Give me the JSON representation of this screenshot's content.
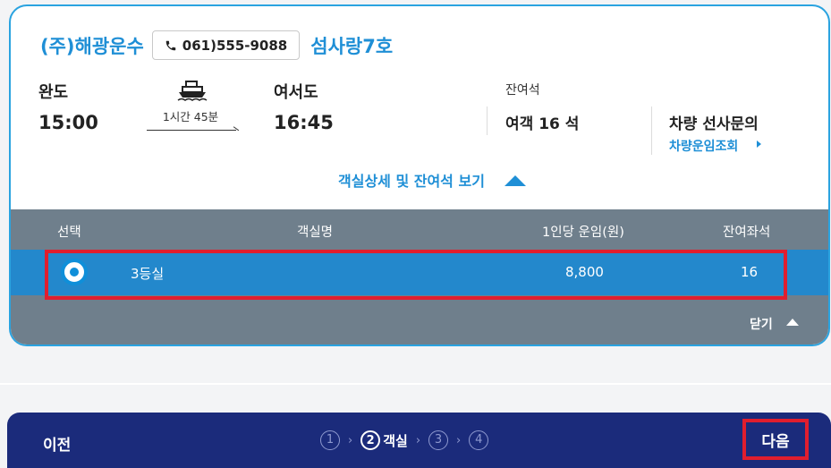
{
  "header": {
    "company": "(주)해광운수",
    "phone": "061)555-9088",
    "ship": "섬사랑7호"
  },
  "route": {
    "from_port": "완도",
    "from_time": "15:00",
    "duration": "1시간 45분",
    "to_port": "여서도",
    "to_time": "16:45"
  },
  "remaining": {
    "label": "잔여석",
    "passengers": "여객 16 석",
    "vehicle": "차량 선사문의",
    "vehicle_link": "차량운임조회"
  },
  "toggle_label": "객실상세 및 잔여석 보기",
  "table": {
    "headers": [
      "선택",
      "객실명",
      "1인당 운임(원)",
      "잔여좌석"
    ],
    "rows": [
      {
        "room": "3등실",
        "fare": "8,800",
        "seats": "16"
      }
    ],
    "close_label": "닫기"
  },
  "footer": {
    "prev_label": "이전",
    "steps": [
      {
        "num": "1",
        "label": ""
      },
      {
        "num": "2",
        "label": "객실"
      },
      {
        "num": "3",
        "label": ""
      },
      {
        "num": "4",
        "label": ""
      }
    ],
    "step_sep": "›",
    "next_label": "다음"
  },
  "colors": {
    "accent": "#1f8fd6",
    "table_bg": "#6f7f8c",
    "selected_row": "#2388cc",
    "footer_bg": "#1b2b7b",
    "highlight": "#e01e2e"
  }
}
